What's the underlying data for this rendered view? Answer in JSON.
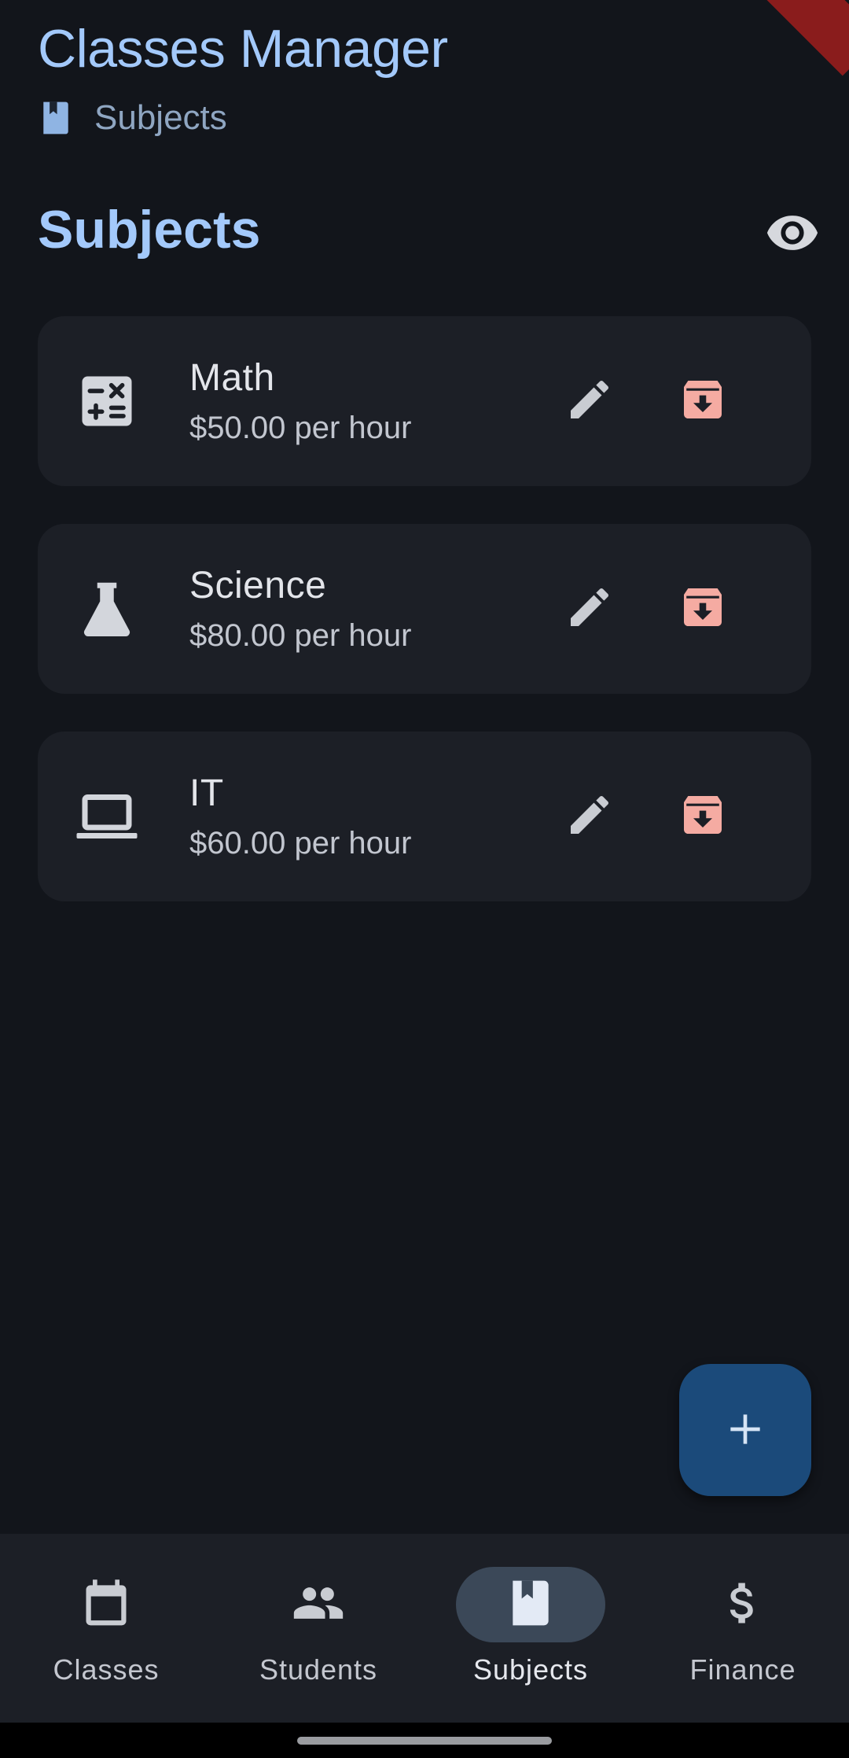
{
  "app": {
    "title": "Classes Manager"
  },
  "breadcrumb": {
    "icon": "book-icon",
    "label": "Subjects"
  },
  "page": {
    "section_title": "Subjects",
    "visibility_icon": "eye-icon"
  },
  "subjects": [
    {
      "name": "Math",
      "rate": "$50.00 per hour",
      "icon": "calculator-icon"
    },
    {
      "name": "Science",
      "rate": "$80.00 per hour",
      "icon": "flask-icon"
    },
    {
      "name": "IT",
      "rate": "$60.00 per hour",
      "icon": "laptop-icon"
    }
  ],
  "actions": {
    "edit_icon": "pencil-icon",
    "archive_icon": "archive-icon"
  },
  "fab": {
    "icon": "plus-icon"
  },
  "nav": {
    "items": [
      {
        "label": "Classes",
        "icon": "calendar-icon",
        "active": false
      },
      {
        "label": "Students",
        "icon": "people-icon",
        "active": false
      },
      {
        "label": "Subjects",
        "icon": "book-icon",
        "active": true
      },
      {
        "label": "Finance",
        "icon": "dollar-icon",
        "active": false
      }
    ]
  },
  "colors": {
    "background": "#12151b",
    "card": "#1c1f26",
    "accent": "#a3c9fb",
    "archive": "#f5aba2",
    "fab": "#1b4a7a",
    "nav_active_pill": "#3b4858"
  }
}
